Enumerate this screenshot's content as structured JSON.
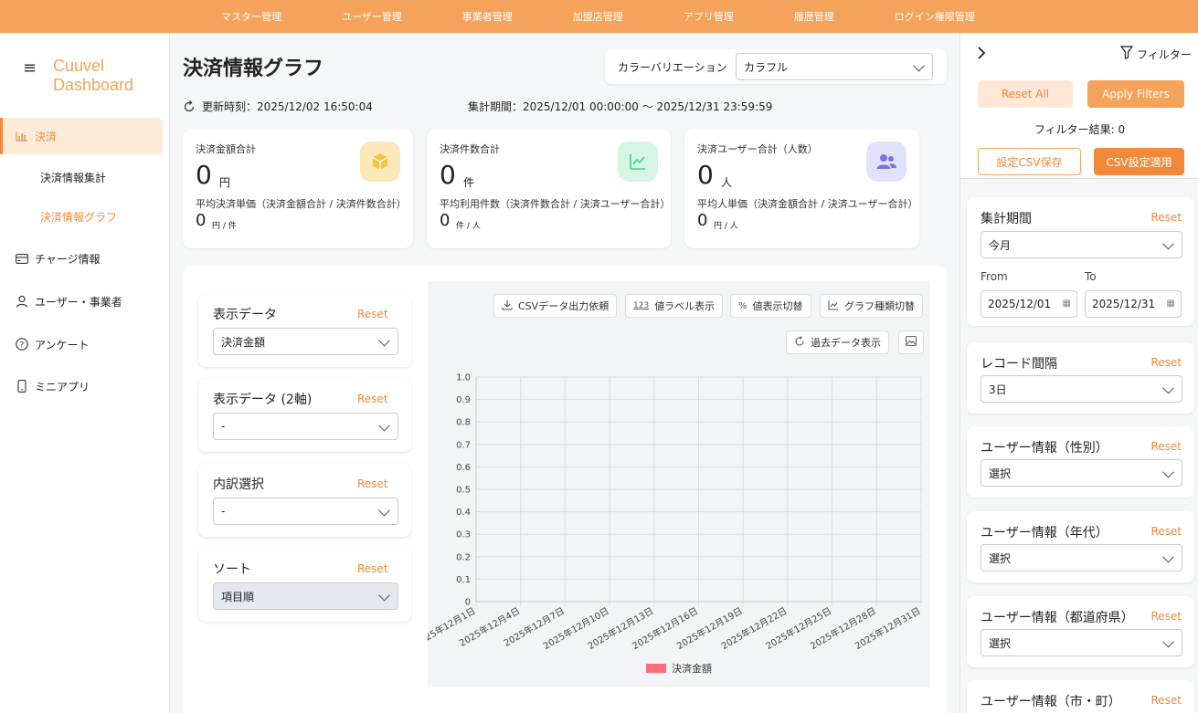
{
  "topnav": [
    "マスター管理",
    "ユーザー管理",
    "事業者管理",
    "加盟店管理",
    "アプリ管理",
    "履歴管理",
    "ログイン権限管理"
  ],
  "brand": {
    "line1": "Cuuvel",
    "line2": "Dashboard"
  },
  "sidebar": {
    "items": [
      {
        "label": "決済",
        "icon": "bar-chart-icon",
        "active": true
      },
      {
        "label": "チャージ情報",
        "icon": "card-icon"
      },
      {
        "label": "ユーザー・事業者",
        "icon": "user-icon"
      },
      {
        "label": "アンケート",
        "icon": "question-icon"
      },
      {
        "label": "ミニアプリ",
        "icon": "phone-icon"
      }
    ],
    "sub_items": [
      {
        "label": "決済情報集計",
        "active": false
      },
      {
        "label": "決済情報グラフ",
        "active": true
      }
    ]
  },
  "page": {
    "title": "決済情報グラフ",
    "color_variation_label": "カラーバリエーション",
    "color_variation_value": "カラフル",
    "updated": "更新時刻：2025/12/02 16:50:04",
    "period": "集計期間：2025/12/01 00:00:00 〜 2025/12/31 23:59:59"
  },
  "cards": [
    {
      "title": "決済金額合計",
      "value": "0",
      "unit": "円",
      "sub": "平均決済単価（決済金額合計 / 決済件数合計）",
      "sub_value": "0",
      "sub_unit": "円 / 件",
      "icon": "box-icon",
      "color": "#fbe8b8",
      "icon_color": "#f5c443"
    },
    {
      "title": "決済件数合計",
      "value": "0",
      "unit": "件",
      "sub": "平均利用件数（決済件数合計 / 決済ユーザー合計）",
      "sub_value": "0",
      "sub_unit": "件 / 人",
      "icon": "line-chart-icon",
      "color": "#d7f5e4",
      "icon_color": "#3ccf8a"
    },
    {
      "title": "決済ユーザー合計（人数）",
      "value": "0",
      "unit": "人",
      "sub": "平均人単価（決済金額合計 / 決済ユーザー合計）",
      "sub_value": "0",
      "sub_unit": "円 / 人",
      "icon": "users-icon",
      "color": "#e3e2fb",
      "icon_color": "#7a73e6"
    }
  ],
  "controls": [
    {
      "title": "表示データ",
      "value": "決済金額",
      "reset": "Reset"
    },
    {
      "title": "表示データ (2軸)",
      "value": "-",
      "reset": "Reset"
    },
    {
      "title": "内訳選択",
      "value": "-",
      "reset": "Reset"
    },
    {
      "title": "ソート",
      "value": "項目順",
      "reset": "Reset",
      "disabled": true
    }
  ],
  "toolbar": {
    "csv": "CSVデータ出力依頼",
    "labels_icon": "123",
    "labels": "値ラベル表示",
    "percent": "値表示切替",
    "type": "グラフ種類切替",
    "past": "過去データ表示"
  },
  "chart_data": {
    "type": "bar",
    "categories": [
      "2025年12月1日",
      "2025年12月4日",
      "2025年12月7日",
      "2025年12月10日",
      "2025年12月13日",
      "2025年12月16日",
      "2025年12月19日",
      "2025年12月22日",
      "2025年12月25日",
      "2025年12月28日",
      "2025年12月31日"
    ],
    "series": [
      {
        "name": "決済金額",
        "values": [
          0,
          0,
          0,
          0,
          0,
          0,
          0,
          0,
          0,
          0,
          0
        ],
        "color": "#ff6b7a"
      }
    ],
    "yticks": [
      "1.0",
      "0.9",
      "0.8",
      "0.7",
      "0.6",
      "0.5",
      "0.4",
      "0.3",
      "0.2",
      "0.1",
      "0"
    ],
    "ylim": [
      0,
      1
    ],
    "grid": true,
    "legend": "bottom"
  },
  "right": {
    "filter_label": "フィルター",
    "reset_all": "Reset All",
    "apply": "Apply Filters",
    "result": "フィルター結果: 0",
    "save_csv": "設定CSV保存",
    "apply_csv": "CSV設定適用",
    "period": {
      "title": "集計期間",
      "reset": "Reset",
      "value": "今月",
      "from_label": "From",
      "to_label": "To",
      "from": "2025/12/01",
      "to": "2025/12/31"
    },
    "filters": [
      {
        "title": "レコード間隔",
        "reset": "Reset",
        "value": "3日"
      },
      {
        "title": "ユーザー情報（性別）",
        "reset": "Reset",
        "value": "選択"
      },
      {
        "title": "ユーザー情報（年代）",
        "reset": "Reset",
        "value": "選択"
      },
      {
        "title": "ユーザー情報（都道府県）",
        "reset": "Reset",
        "value": "選択"
      },
      {
        "title": "ユーザー情報（市・町）",
        "reset": "Reset"
      }
    ]
  }
}
